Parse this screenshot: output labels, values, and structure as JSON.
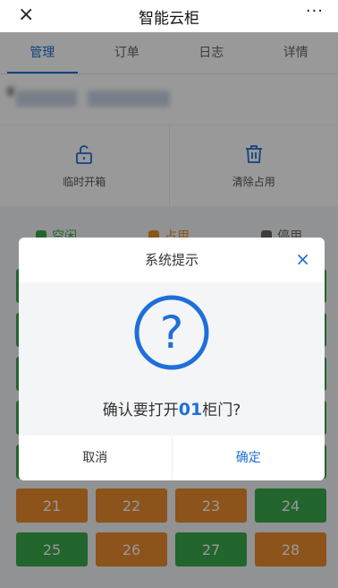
{
  "header": {
    "close_icon": "×",
    "title": "智能云柜",
    "more_icon": "···"
  },
  "tabs": [
    {
      "label": "管理",
      "active": true
    },
    {
      "label": "订单",
      "active": false
    },
    {
      "label": "日志",
      "active": false
    },
    {
      "label": "详情",
      "active": false
    }
  ],
  "actions": [
    {
      "label": "临时开箱",
      "icon": "unlock-icon"
    },
    {
      "label": "清除占用",
      "icon": "trash-icon"
    }
  ],
  "legend": [
    {
      "label": "空闲",
      "color": "#3aa84c"
    },
    {
      "label": "占用",
      "color": "#e98a2c"
    },
    {
      "label": "停用",
      "color": "#666666"
    }
  ],
  "grid": {
    "rows": [
      [
        {
          "n": "",
          "s": "green"
        },
        {
          "n": "",
          "s": "green"
        },
        {
          "n": "",
          "s": "green"
        },
        {
          "n": "",
          "s": "green"
        }
      ],
      [
        {
          "n": "",
          "s": "green"
        },
        {
          "n": "",
          "s": "green"
        },
        {
          "n": "",
          "s": "green"
        },
        {
          "n": "",
          "s": "green"
        }
      ],
      [
        {
          "n": "",
          "s": "green"
        },
        {
          "n": "",
          "s": "green"
        },
        {
          "n": "",
          "s": "green"
        },
        {
          "n": "",
          "s": "green"
        }
      ],
      [
        {
          "n": "",
          "s": "green"
        },
        {
          "n": "",
          "s": "green"
        },
        {
          "n": "",
          "s": "green"
        },
        {
          "n": "",
          "s": "green"
        }
      ],
      [
        {
          "n": "",
          "s": "green"
        },
        {
          "n": "",
          "s": "green"
        },
        {
          "n": "",
          "s": "green"
        },
        {
          "n": "",
          "s": "green"
        }
      ],
      [
        {
          "n": "21",
          "s": "orange"
        },
        {
          "n": "22",
          "s": "orange"
        },
        {
          "n": "23",
          "s": "orange"
        },
        {
          "n": "24",
          "s": "green"
        }
      ],
      [
        {
          "n": "25",
          "s": "green"
        },
        {
          "n": "26",
          "s": "orange"
        },
        {
          "n": "27",
          "s": "green"
        },
        {
          "n": "28",
          "s": "orange"
        }
      ]
    ]
  },
  "dialog": {
    "title": "系统提示",
    "close_icon": "×",
    "icon": "question-circle-icon",
    "message_prefix": "确认要打开",
    "door_number": "01",
    "message_suffix": "柜门?",
    "cancel_label": "取消",
    "confirm_label": "确定"
  }
}
